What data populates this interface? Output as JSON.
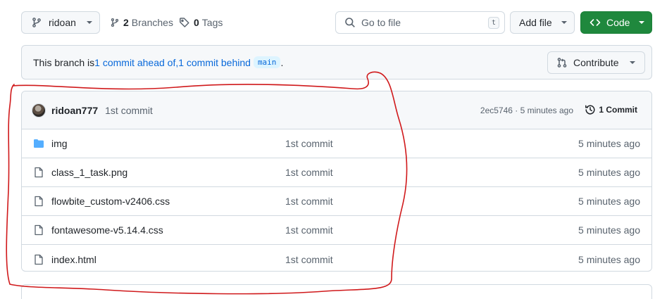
{
  "toolbar": {
    "branch_name": "ridoan",
    "branches_count": "2",
    "branches_label": "Branches",
    "tags_count": "0",
    "tags_label": "Tags",
    "search_placeholder": "Go to file",
    "search_shortcut": "t",
    "add_file_label": "Add file",
    "code_label": "Code"
  },
  "banner": {
    "prefix": "This branch is ",
    "ahead": "1 commit ahead of",
    "separator": ", ",
    "behind": "1 commit behind",
    "base_branch": "main",
    "suffix": " .",
    "contribute_label": "Contribute"
  },
  "latest_commit": {
    "author": "ridoan777",
    "message": "1st commit",
    "meta": "2ec5746 · 5 minutes ago",
    "history_label": "1 Commit"
  },
  "files": [
    {
      "type": "folder",
      "name": "img",
      "commit": "1st commit",
      "age": "5 minutes ago"
    },
    {
      "type": "file",
      "name": "class_1_task.png",
      "commit": "1st commit",
      "age": "5 minutes ago"
    },
    {
      "type": "file",
      "name": "flowbite_custom-v2406.css",
      "commit": "1st commit",
      "age": "5 minutes ago"
    },
    {
      "type": "file",
      "name": "fontawesome-v5.14.4.css",
      "commit": "1st commit",
      "age": "5 minutes ago"
    },
    {
      "type": "file",
      "name": "index.html",
      "commit": "1st commit",
      "age": "5 minutes ago"
    }
  ],
  "icons": {
    "branch": "git-branch-icon",
    "tag": "tag-icon",
    "search": "search-icon",
    "code": "code-icon",
    "pull_request": "git-pull-request-icon",
    "history": "history-icon",
    "folder": "folder-icon",
    "file": "file-icon"
  },
  "colors": {
    "accent_link": "#0969da",
    "code_button": "#1f883d",
    "folder_icon": "#54aeff",
    "annotation_stroke": "#d0191b"
  }
}
